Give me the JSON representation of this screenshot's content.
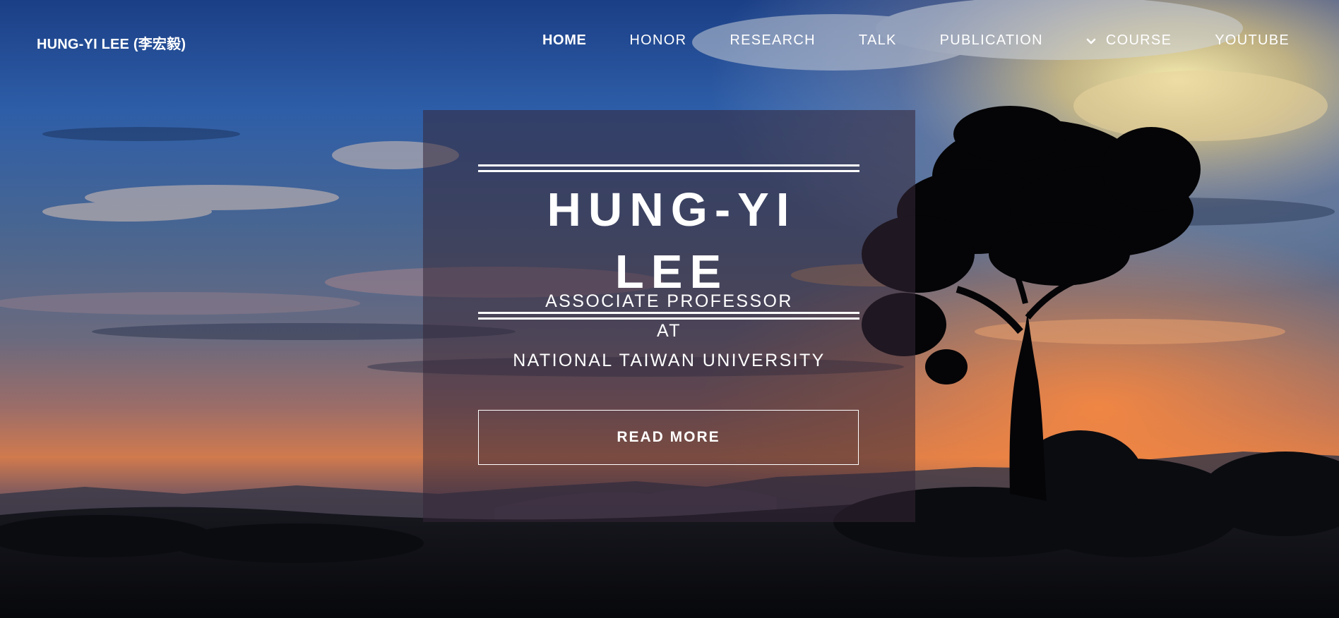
{
  "brand": "HUNG-YI LEE (李宏毅)",
  "nav": {
    "items": [
      {
        "label": "HOME",
        "active": true
      },
      {
        "label": "HONOR"
      },
      {
        "label": "RESEARCH"
      },
      {
        "label": "TALK"
      },
      {
        "label": "PUBLICATION"
      },
      {
        "label": "COURSE",
        "icon": "chevron-down-icon"
      },
      {
        "label": "YOUTUBE"
      }
    ]
  },
  "hero": {
    "title": "HUNG-YI LEE",
    "subtitle_lines": [
      "ASSOCIATE PROFESSOR",
      "AT",
      "NATIONAL TAIWAN UNIVERSITY"
    ],
    "button_label": "READ MORE",
    "background": "sunset landscape with tree silhouette",
    "colors": {
      "sky_top": "#1f4f9e",
      "sunset": "#e58a4e",
      "panel_overlay": "#342636",
      "text": "#ffffff"
    }
  }
}
